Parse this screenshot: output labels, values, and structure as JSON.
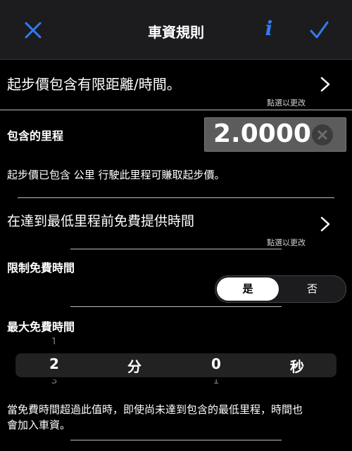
{
  "header": {
    "title": "車資規則",
    "info_label": "i",
    "close_icon": "close-icon",
    "confirm_icon": "checkmark-icon",
    "accent_color": "#2f7df6"
  },
  "base_fare_row": {
    "label": "起步價包含有限距離/時間。",
    "hint": "點選以更改"
  },
  "included_distance": {
    "label": "包含的里程",
    "value": "2.0000",
    "description": "起步價已包含 公里 行駛此里程可賺取起步價。"
  },
  "free_time_row": {
    "label": "在達到最低里程前免費提供時間",
    "hint": "點選以更改"
  },
  "limit_free_time": {
    "label": "限制免費時間",
    "options": [
      "是",
      "否"
    ],
    "selected": "是"
  },
  "max_free_time": {
    "label": "最大免費時間",
    "minutes": "2",
    "minutes_above": "1",
    "minutes_below": "3",
    "minutes_unit": "分",
    "seconds": "0",
    "seconds_below": "1",
    "seconds_unit": "秒"
  },
  "footer_note": {
    "line1": "當免費時間超過此值時，即使尚未達到包含的最低里程，時間也",
    "line2": "會加入車資。"
  }
}
